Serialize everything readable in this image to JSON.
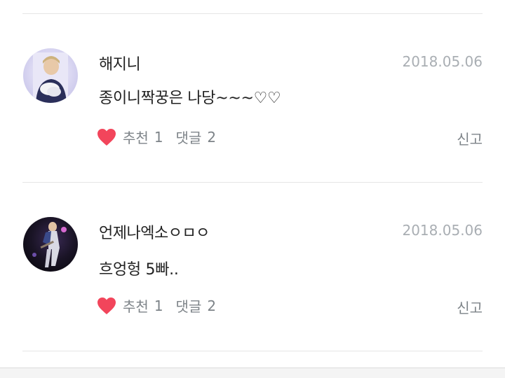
{
  "comments": [
    {
      "username": "해지니",
      "date": "2018.05.06",
      "text": "종이니짝꿍은 나당~~~♡♡",
      "like_label": "추천",
      "like_count": "1",
      "reply_label": "댓글",
      "reply_count": "2",
      "report_label": "신고"
    },
    {
      "username": "언제나엑소ㅇㅁㅇ",
      "date": "2018.05.06",
      "text": "흐엉헝 5빠..",
      "like_label": "추천",
      "like_count": "1",
      "reply_label": "댓글",
      "reply_count": "2",
      "report_label": "신고"
    }
  ],
  "colors": {
    "heart": "#f2455b",
    "divider": "#e6e6e6",
    "meta_text": "#7d8388",
    "date_text": "#a9aeb3"
  },
  "icons": {
    "like": "heart-icon"
  }
}
